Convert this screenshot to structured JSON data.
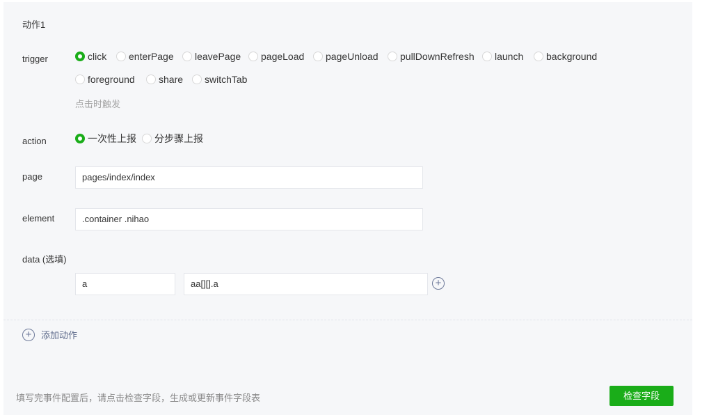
{
  "section_title": "动作1",
  "trigger": {
    "label": "trigger",
    "options": [
      "click",
      "enterPage",
      "leavePage",
      "pageLoad",
      "pageUnload",
      "pullDownRefresh",
      "launch",
      "background",
      "foreground",
      "share",
      "switchTab"
    ],
    "selected": "click",
    "hint": "点击时触发"
  },
  "action": {
    "label": "action",
    "options": [
      "一次性上报",
      "分步骤上报"
    ],
    "selected": "一次性上报"
  },
  "page": {
    "label": "page",
    "value": "pages/index/index"
  },
  "element": {
    "label": "element",
    "value": ".container .nihao"
  },
  "data": {
    "label": "data (选填)",
    "key": "a",
    "value": "aa[][].a"
  },
  "add_action": "添加动作",
  "footer": {
    "hint": "填写完事件配置后，请点击检查字段，生成或更新事件字段表",
    "button": "检查字段"
  },
  "colors": {
    "accent": "#1aad19"
  }
}
